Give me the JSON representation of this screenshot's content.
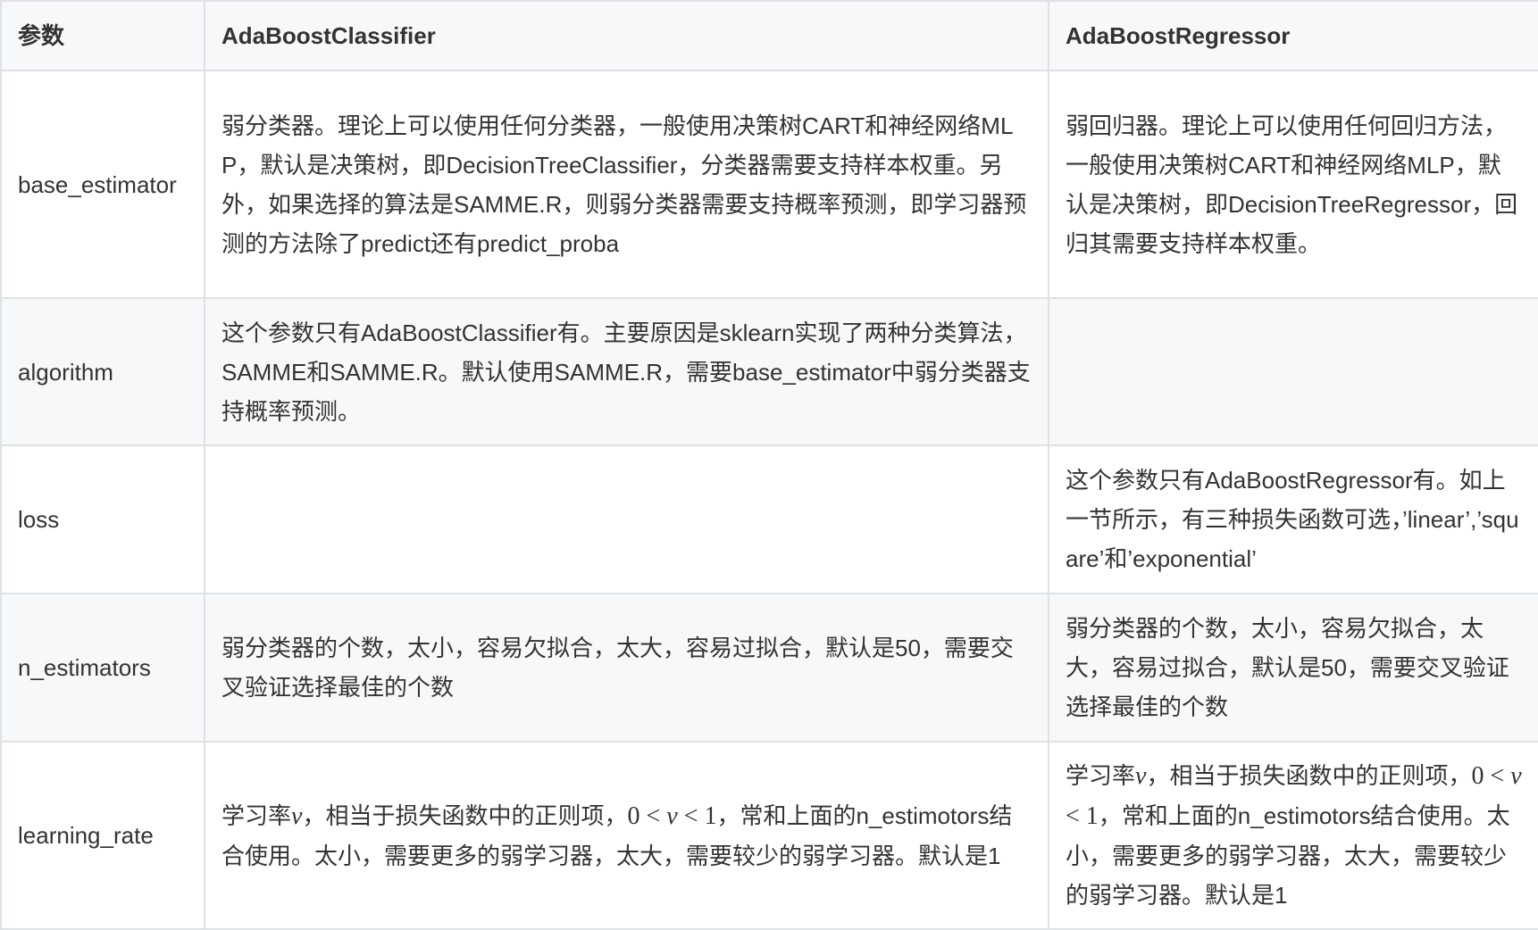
{
  "headers": {
    "param": "参数",
    "classifier": "AdaBoostClassifier",
    "regressor": "AdaBoostRegressor"
  },
  "rows": [
    {
      "name": "base_estimator",
      "classifier": "弱分类器。理论上可以使用任何分类器，一般使用决策树CART和神经网络MLP，默认是决策树，即DecisionTreeClassifier，分类器需要支持样本权重。另外，如果选择的算法是SAMME.R，则弱分类器需要支持概率预测，即学习器预测的方法除了predict还有predict_proba",
      "regressor": "弱回归器。理论上可以使用任何回归方法，一般使用决策树CART和神经网络MLP，默认是决策树，即DecisionTreeRegressor，回归其需要支持样本权重。"
    },
    {
      "name": "algorithm",
      "classifier": "这个参数只有AdaBoostClassifier有。主要原因是sklearn实现了两种分类算法，SAMME和SAMME.R。默认使用SAMME.R，需要base_estimator中弱分类器支持概率预测。",
      "regressor": ""
    },
    {
      "name": "loss",
      "classifier": "",
      "regressor": "这个参数只有AdaBoostRegressor有。如上一节所示，有三种损失函数可选，’linear’,’square’和’exponential’"
    },
    {
      "name": "n_estimators",
      "classifier": "弱分类器的个数，太小，容易欠拟合，太大，容易过拟合，默认是50，需要交叉验证选择最佳的个数",
      "regressor": "弱分类器的个数，太小，容易欠拟合，太大，容易过拟合，默认是50，需要交叉验证选择最佳的个数"
    },
    {
      "name": "learning_rate",
      "classifier": {
        "p1": "学习率",
        "var": "v",
        "p2": "，相当于损失函数中的正则项，",
        "math_zero": "0",
        "math_lt1": "<",
        "math_var": "v",
        "math_lt2": "<",
        "math_one": "1",
        "p3": "，常和上面的n_estimotors结合使用。太小，需要更多的弱学习器，太大，需要较少的弱学习器。默认是1"
      },
      "regressor": {
        "p1": "学习率",
        "var": "v",
        "p2": "，相当于损失函数中的正则项，",
        "math_zero": "0",
        "math_lt1": "<",
        "math_var": "v",
        "math_lt2": "<",
        "math_one": "1",
        "p3": "，常和上面的n_estimotors结合使用。太小，需要更多的弱学习器，太大，需要较少的弱学习器。默认是1"
      }
    }
  ]
}
